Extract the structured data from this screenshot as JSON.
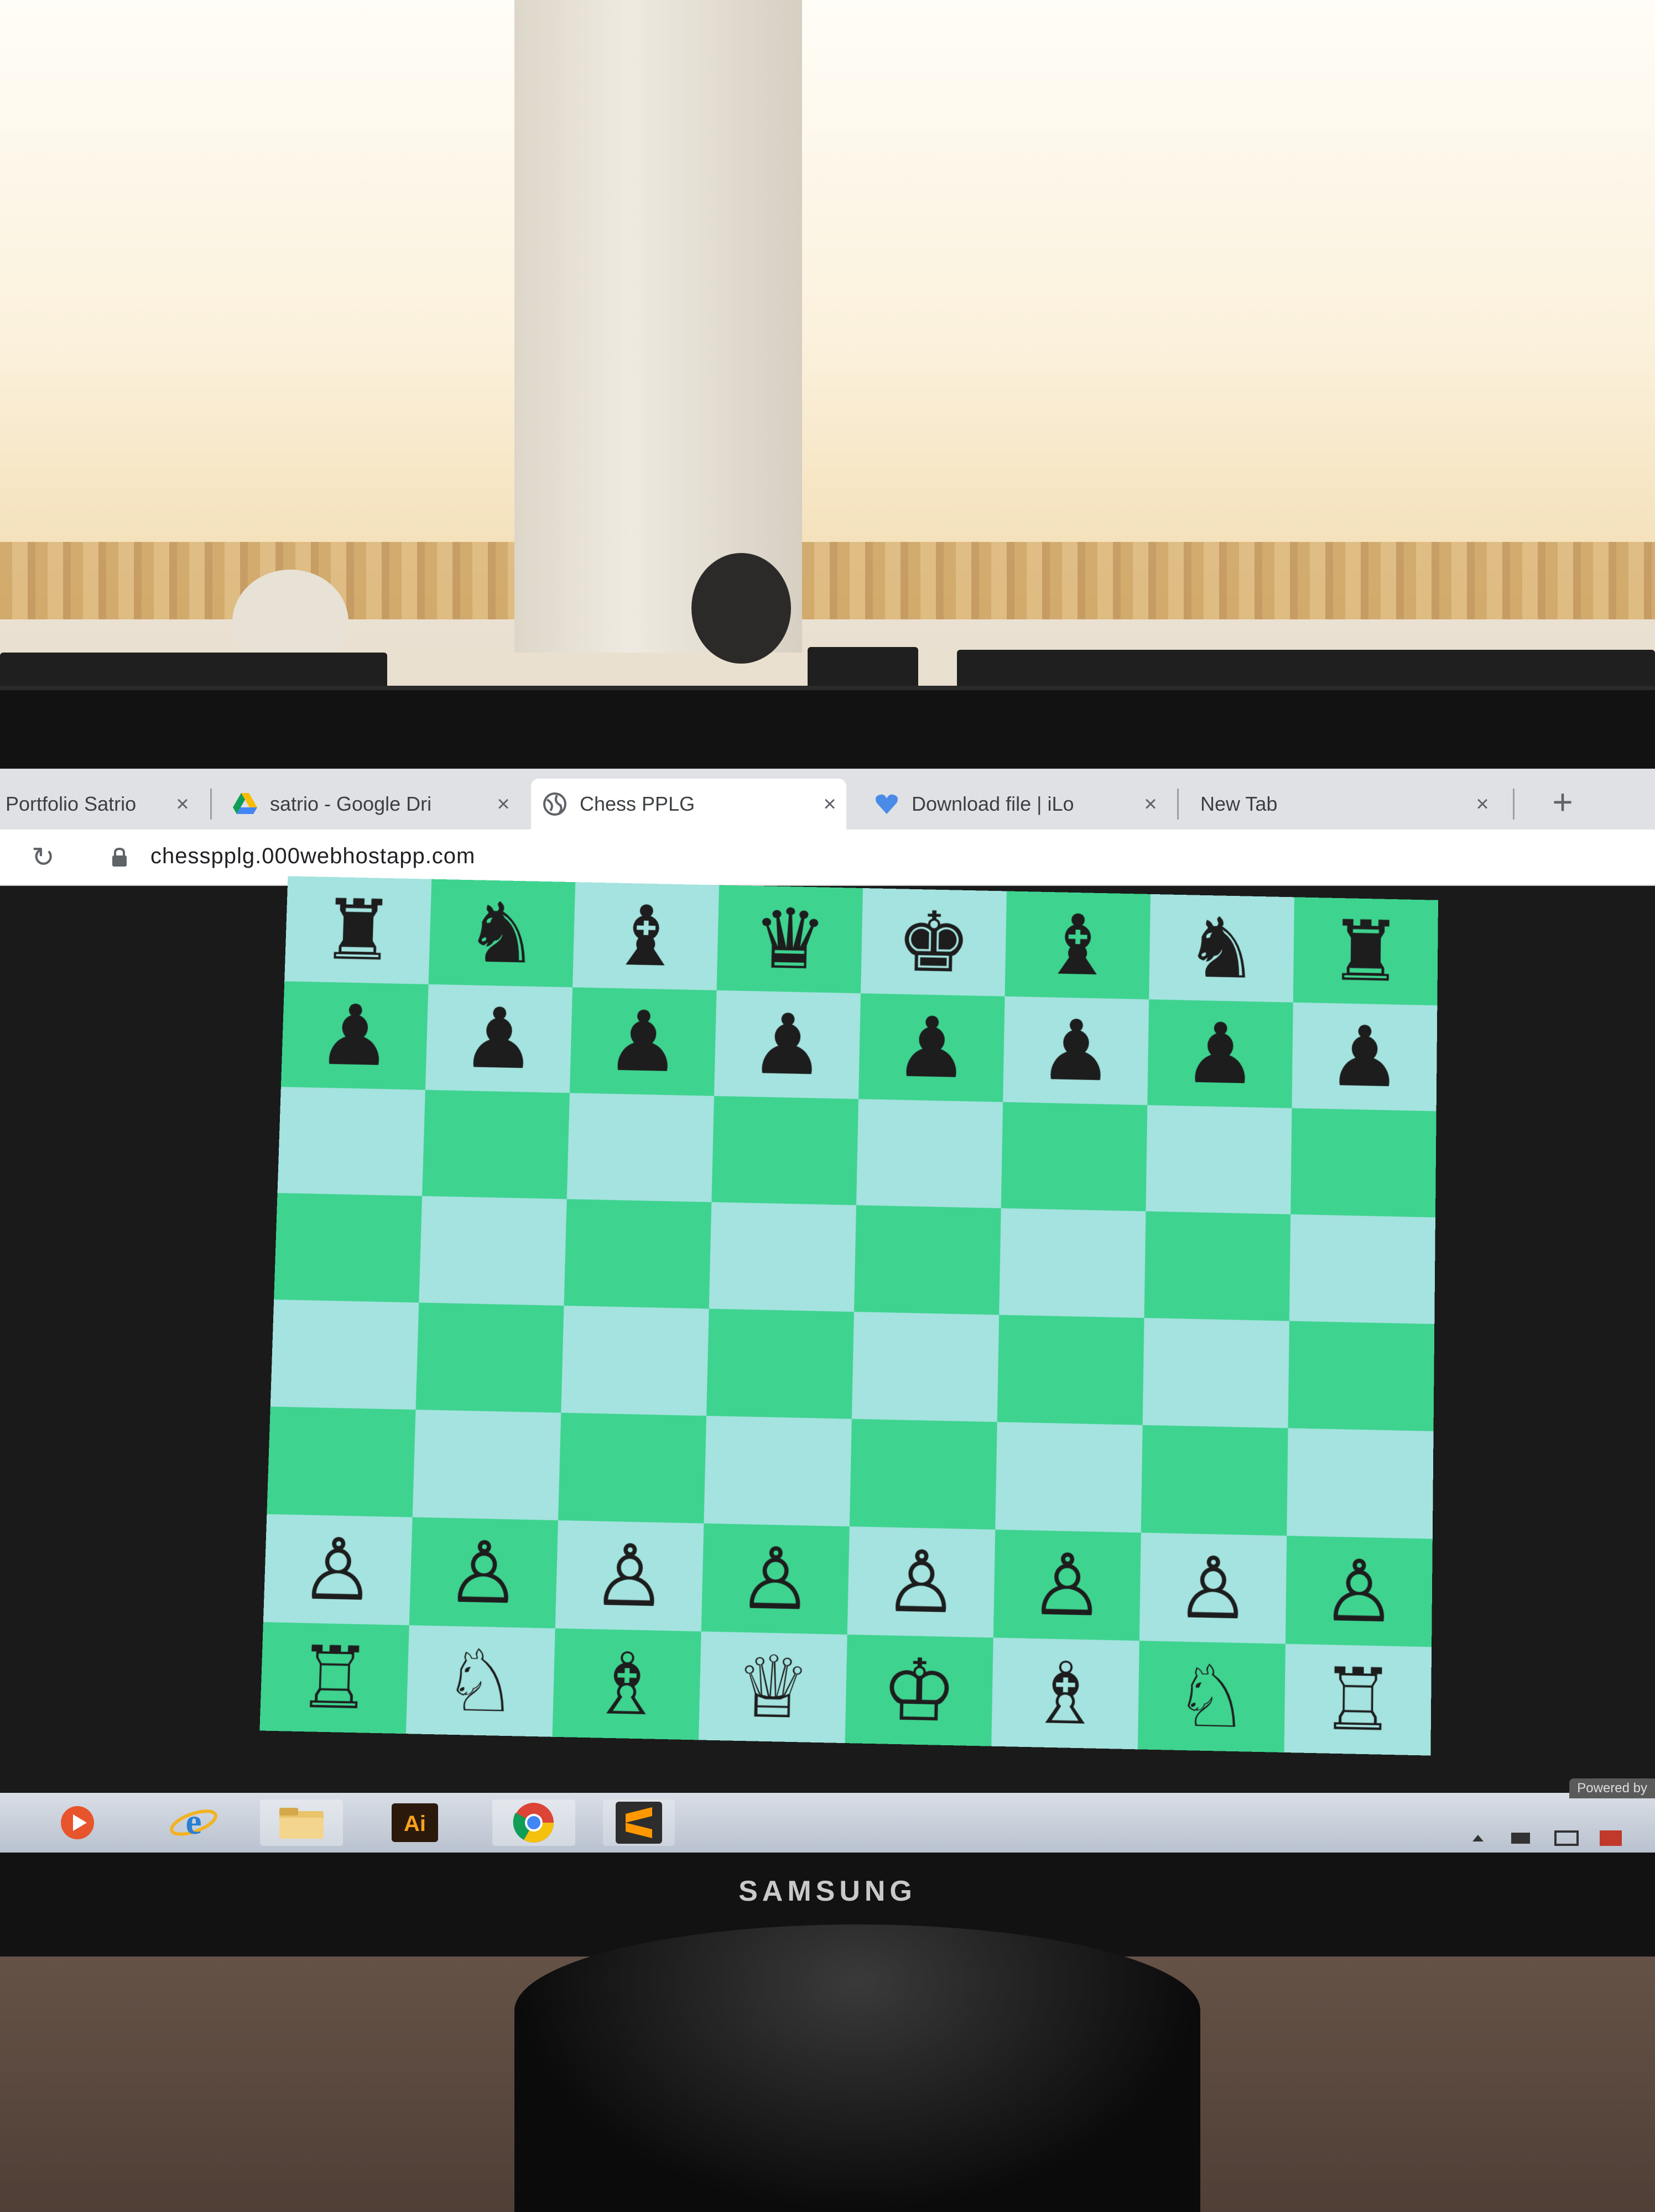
{
  "browser": {
    "tabs": [
      {
        "label": "Portfolio Satrio",
        "icon": "page-icon",
        "active": false
      },
      {
        "label": "satrio - Google Dri",
        "icon": "google-drive-icon",
        "active": false
      },
      {
        "label": "Chess PPLG",
        "icon": "globe-icon",
        "active": true
      },
      {
        "label": "Download file | iLo",
        "icon": "heart-icon",
        "active": false
      },
      {
        "label": "New Tab",
        "icon": "none",
        "active": false
      }
    ],
    "close_glyph": "×",
    "new_tab_glyph": "+",
    "reload_glyph": "↻",
    "url": "chesspplg.000webhostapp.com"
  },
  "board": {
    "light_color": "#a4e3df",
    "dark_color": "#3fd390",
    "rows": [
      [
        "♜",
        "♞",
        "♝",
        "♛",
        "♚",
        "♝",
        "♞",
        "♜"
      ],
      [
        "♟",
        "♟",
        "♟",
        "♟",
        "♟",
        "♟",
        "♟",
        "♟"
      ],
      [
        "",
        "",
        "",
        "",
        "",
        "",
        "",
        ""
      ],
      [
        "",
        "",
        "",
        "",
        "",
        "",
        "",
        ""
      ],
      [
        "",
        "",
        "",
        "",
        "",
        "",
        "",
        ""
      ],
      [
        "",
        "",
        "",
        "",
        "",
        "",
        "",
        ""
      ],
      [
        "♙",
        "♙",
        "♙",
        "♙",
        "♙",
        "♙",
        "♙",
        "♙"
      ],
      [
        "♖",
        "♘",
        "♗",
        "♕",
        "♔",
        "♗",
        "♘",
        "♖"
      ]
    ]
  },
  "taskbar": {
    "apps": [
      {
        "name": "media-player-icon",
        "label": "▶"
      },
      {
        "name": "internet-explorer-icon",
        "label": "e"
      },
      {
        "name": "file-explorer-icon",
        "label": "📁"
      },
      {
        "name": "illustrator-icon",
        "label": "Ai"
      },
      {
        "name": "chrome-icon",
        "label": "●"
      },
      {
        "name": "sublime-text-icon",
        "label": "S"
      }
    ],
    "powered_text": "Powered by"
  },
  "monitor": {
    "brand": "SAMSUNG"
  }
}
